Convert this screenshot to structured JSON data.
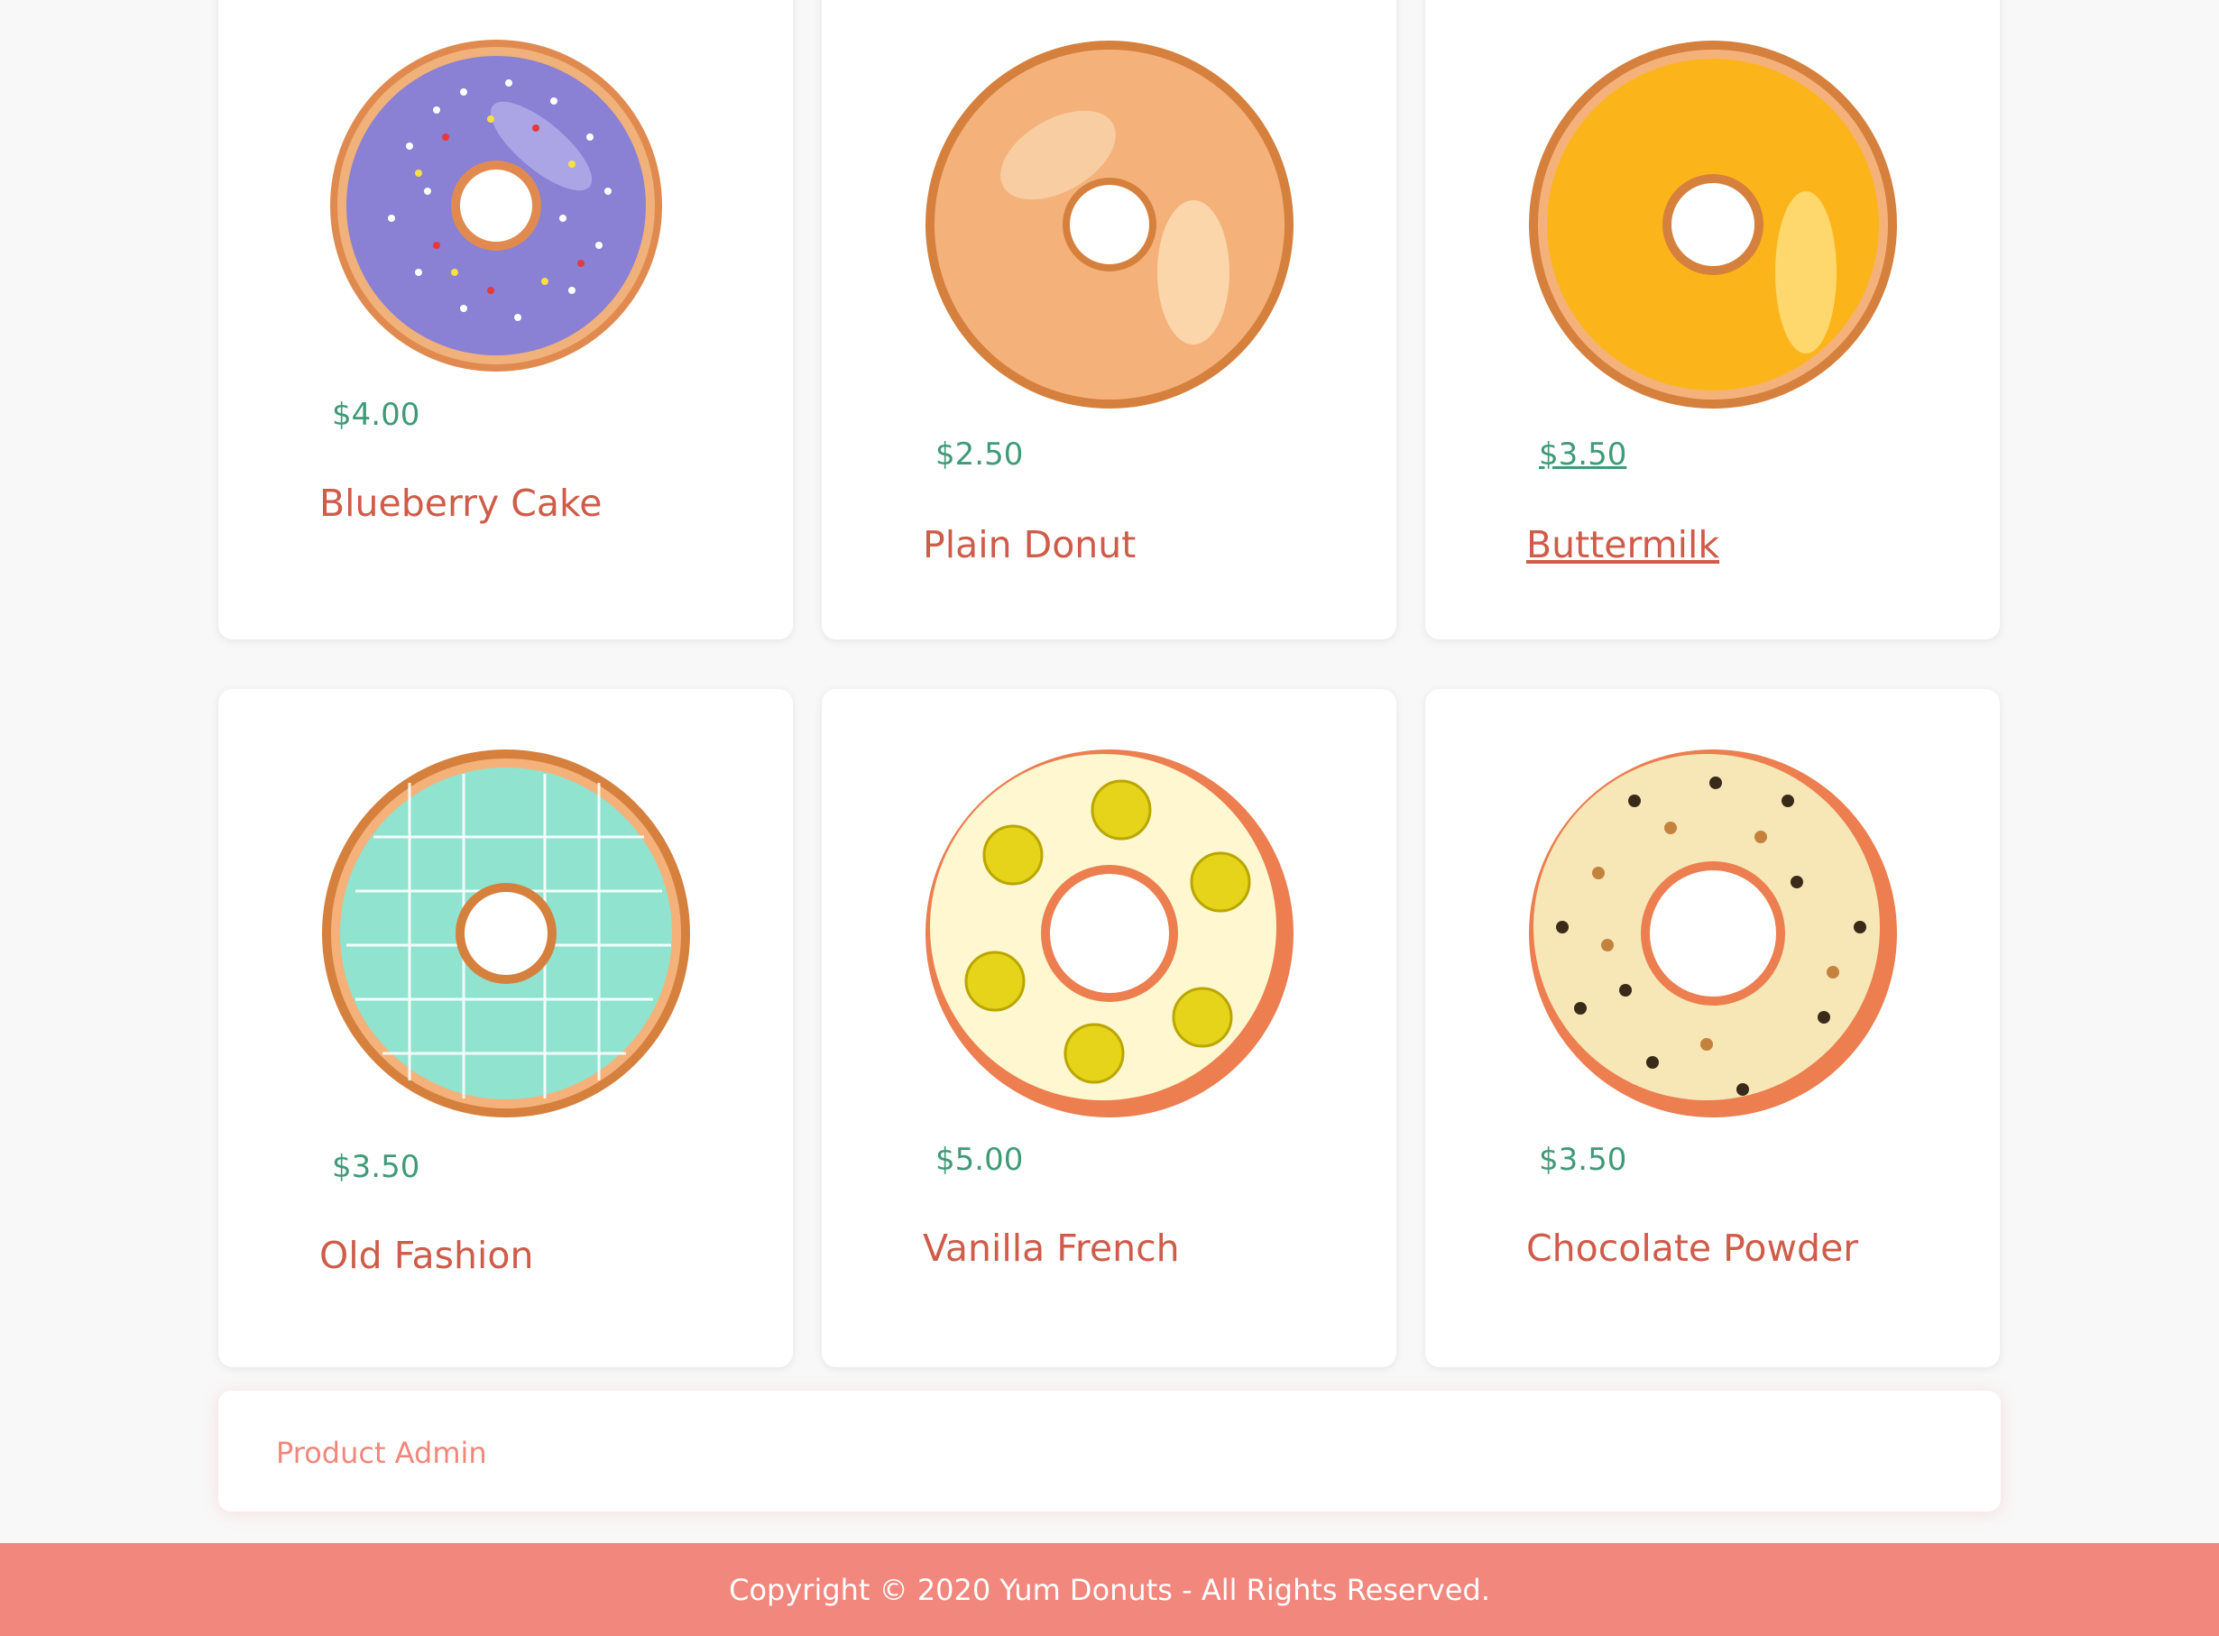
{
  "products": [
    {
      "name": "Blueberry Cake",
      "price": "$4.00",
      "icon": "blueberry-donut-image"
    },
    {
      "name": "Plain Donut",
      "price": "$2.50",
      "icon": "plain-donut-image"
    },
    {
      "name": "Buttermilk",
      "price": "$3.50",
      "icon": "buttermilk-donut-image"
    },
    {
      "name": "Old Fashion",
      "price": "$3.50",
      "icon": "old-fashion-donut-image"
    },
    {
      "name": "Vanilla French",
      "price": "$5.00",
      "icon": "vanilla-french-donut-image"
    },
    {
      "name": "Chocolate Powder",
      "price": "$3.50",
      "icon": "chocolate-powder-donut-image"
    }
  ],
  "admin": {
    "label": "Product Admin"
  },
  "footer": {
    "text": "Copyright © 2020 Yum Donuts - All Rights Reserved."
  },
  "colors": {
    "accent": "#f2877d",
    "price": "#3f9a78",
    "name": "#cf5b49",
    "background": "#f8f8f8"
  }
}
